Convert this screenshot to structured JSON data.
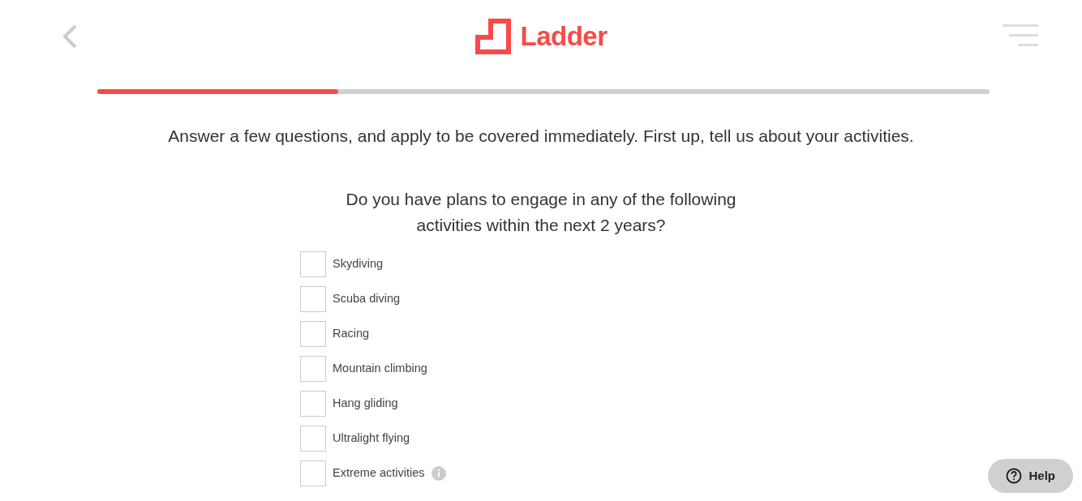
{
  "header": {
    "logo_text": "Ladder"
  },
  "progress": {
    "level": 0.27
  },
  "intro": "Answer a few questions, and apply to be covered immediately. First up, tell us about your activities.",
  "question": {
    "lines": [
      "Do you have plans to engage in any of the following",
      "activities within the next 2 years?"
    ]
  },
  "options": [
    {
      "label": "Skydiving",
      "checked": false,
      "info": false
    },
    {
      "label": "Scuba diving",
      "checked": false,
      "info": false
    },
    {
      "label": "Racing",
      "checked": false,
      "info": false
    },
    {
      "label": "Mountain climbing",
      "checked": false,
      "info": false
    },
    {
      "label": "Hang gliding",
      "checked": false,
      "info": false
    },
    {
      "label": "Ultralight flying",
      "checked": false,
      "info": false
    },
    {
      "label": "Extreme activities",
      "checked": false,
      "info": true
    }
  ],
  "help_button": {
    "label": "Help"
  }
}
